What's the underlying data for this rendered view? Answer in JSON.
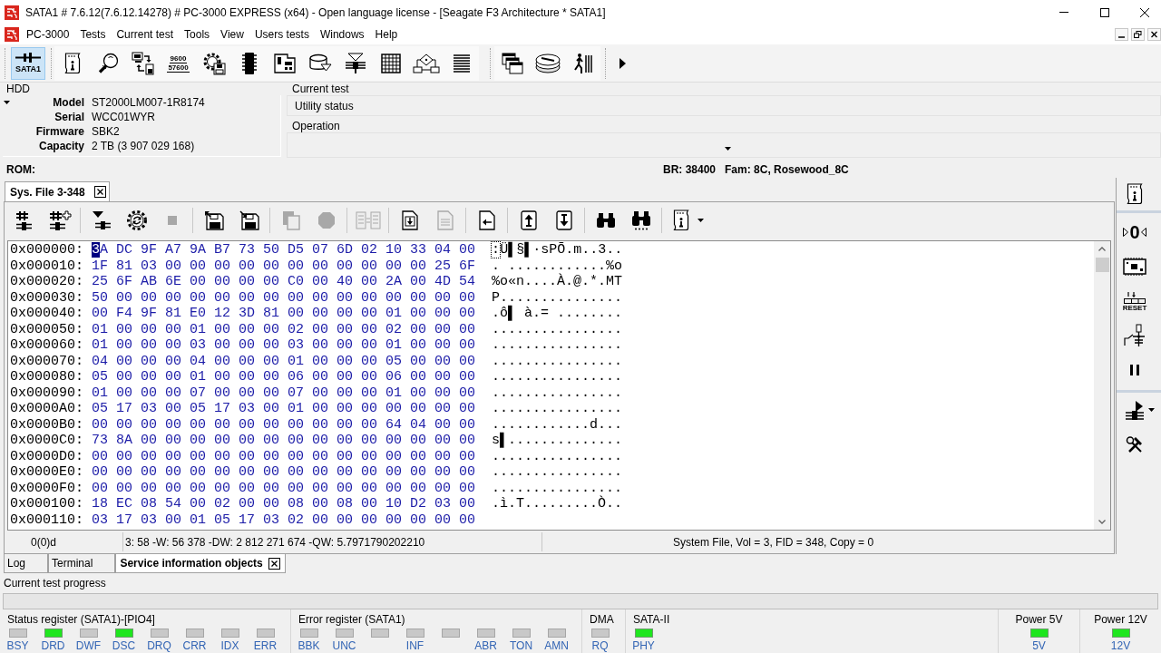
{
  "window": {
    "title": "SATA1 # 7.6.12(7.6.12.14278) # PC-3000 EXPRESS (x64) - Open language license - [Seagate F3 Architecture * SATA1]"
  },
  "menu_bar": {
    "items": [
      "PC-3000",
      "Tests",
      "Current test",
      "Tools",
      "View",
      "Users tests",
      "Windows",
      "Help"
    ]
  },
  "toolbar": {
    "port_button": {
      "label": "SATA1",
      "selected": true
    },
    "baud_button": {
      "lines": [
        "9600",
        "57600"
      ]
    }
  },
  "hdd": {
    "title": "HDD",
    "fields": [
      {
        "label": "Model",
        "value": "ST2000LM007-1R8174"
      },
      {
        "label": "Serial",
        "value": "WCC01WYR"
      },
      {
        "label": "Firmware",
        "value": "SBK2"
      },
      {
        "label": "Capacity",
        "value": "2 TB (3 907 029 168)"
      }
    ]
  },
  "current_test": {
    "title": "Current test",
    "value": "Utility status"
  },
  "operation": {
    "title": "Operation"
  },
  "rom_bar": {
    "rom": "ROM:",
    "baud": "BR: 38400",
    "family": "Fam: 8C, Rosewood_8C"
  },
  "document_tab": {
    "label": "Sys. File 3-348"
  },
  "document_toolbar": {
    "groups": [
      {
        "buttons": [
          {
            "disabled": false
          },
          {
            "disabled": false
          }
        ]
      },
      {
        "buttons": [
          {
            "disabled": false
          },
          {
            "disabled": false
          },
          {
            "disabled": true
          }
        ]
      },
      {
        "buttons": [
          {
            "disabled": false
          },
          {
            "disabled": false
          }
        ]
      },
      {
        "buttons": [
          {
            "disabled": true
          },
          {
            "disabled": true
          }
        ]
      },
      {
        "buttons": [
          {
            "disabled": true
          }
        ]
      },
      {
        "buttons": [
          {
            "disabled": false
          },
          {
            "disabled": true
          }
        ]
      },
      {
        "buttons": [
          {
            "disabled": false
          }
        ]
      },
      {
        "buttons": [
          {
            "disabled": false
          },
          {
            "disabled": false
          }
        ]
      },
      {
        "buttons": [
          {
            "disabled": false
          },
          {
            "disabled": false
          }
        ]
      },
      {
        "buttons": [
          {
            "disabled": false
          }
        ]
      }
    ]
  },
  "hex_view": {
    "rows": [
      {
        "offset": "0x000000:",
        "hex": "3A DC 9F A7 9A B7 73 50 D5 07 6D 02 10 33 04 00",
        "ascii": ":Ü▌§▌·sPÕ.m..3..",
        "selected": true
      },
      {
        "offset": "0x000010:",
        "hex": "1F 81 03 00 00 00 00 00 00 00 00 00 00 00 25 6F",
        "ascii": ". ............%o",
        "selected": false
      },
      {
        "offset": "0x000020:",
        "hex": "25 6F AB 6E 00 00 00 00 C0 00 40 00 2A 00 4D 54",
        "ascii": "%o«n....À.@.*.MT",
        "selected": false
      },
      {
        "offset": "0x000030:",
        "hex": "50 00 00 00 00 00 00 00 00 00 00 00 00 00 00 00",
        "ascii": "P...............",
        "selected": false
      },
      {
        "offset": "0x000040:",
        "hex": "00 F4 9F 81 E0 12 3D 81 00 00 00 00 01 00 00 00",
        "ascii": ".ô▌ à.= ........",
        "selected": false
      },
      {
        "offset": "0x000050:",
        "hex": "01 00 00 00 01 00 00 00 02 00 00 00 02 00 00 00",
        "ascii": "................",
        "selected": false
      },
      {
        "offset": "0x000060:",
        "hex": "01 00 00 00 03 00 00 00 03 00 00 00 01 00 00 00",
        "ascii": "................",
        "selected": false
      },
      {
        "offset": "0x000070:",
        "hex": "04 00 00 00 04 00 00 00 01 00 00 00 05 00 00 00",
        "ascii": "................",
        "selected": false
      },
      {
        "offset": "0x000080:",
        "hex": "05 00 00 00 01 00 00 00 06 00 00 00 06 00 00 00",
        "ascii": "................",
        "selected": false
      },
      {
        "offset": "0x000090:",
        "hex": "01 00 00 00 07 00 00 00 07 00 00 00 01 00 00 00",
        "ascii": "................",
        "selected": false
      },
      {
        "offset": "0x0000A0:",
        "hex": "05 17 03 00 05 17 03 00 01 00 00 00 00 00 00 00",
        "ascii": "................",
        "selected": false
      },
      {
        "offset": "0x0000B0:",
        "hex": "00 00 00 00 00 00 00 00 00 00 00 00 64 04 00 00",
        "ascii": "............d...",
        "selected": false
      },
      {
        "offset": "0x0000C0:",
        "hex": "73 8A 00 00 00 00 00 00 00 00 00 00 00 00 00 00",
        "ascii": "s▌..............",
        "selected": false
      },
      {
        "offset": "0x0000D0:",
        "hex": "00 00 00 00 00 00 00 00 00 00 00 00 00 00 00 00",
        "ascii": "................",
        "selected": false
      },
      {
        "offset": "0x0000E0:",
        "hex": "00 00 00 00 00 00 00 00 00 00 00 00 00 00 00 00",
        "ascii": "................",
        "selected": false
      },
      {
        "offset": "0x0000F0:",
        "hex": "00 00 00 00 00 00 00 00 00 00 00 00 00 00 00 00",
        "ascii": "................",
        "selected": false
      },
      {
        "offset": "0x000100:",
        "hex": "18 EC 08 54 00 02 00 00 08 00 08 00 10 D2 03 00",
        "ascii": ".ì.T.........Ò..",
        "selected": false
      },
      {
        "offset": "0x000110:",
        "hex": "03 17 03 00 01 05 17 03 02 00 00 00 00 00 00 00",
        "selected": false
      }
    ]
  },
  "document_status": {
    "position": "0(0)d",
    "values": "3: 58 -W: 56 378 -DW: 2 812 271 674 -QW: 5.7971790202210",
    "file_info": "System File, Vol = 3, FID = 348, Copy = 0"
  },
  "side_toolbar": {
    "zero_label": "0",
    "reset_label": "RESET"
  },
  "bottom_tabs": [
    {
      "label": "Log",
      "selected": false
    },
    {
      "label": "Terminal",
      "selected": false
    },
    {
      "label": "Service information objects",
      "selected": true
    }
  ],
  "progress": {
    "label": "Current test progress",
    "level": 0
  },
  "registers": [
    {
      "kind": "register",
      "title": "Status register (SATA1)-[PIO4]",
      "leds": [
        {
          "label": "BSY",
          "on": false
        },
        {
          "label": "DRD",
          "on": true
        },
        {
          "label": "DWF",
          "on": false
        },
        {
          "label": "DSC",
          "on": true
        },
        {
          "label": "DRQ",
          "on": false
        },
        {
          "label": "CRR",
          "on": false
        },
        {
          "label": "IDX",
          "on": false
        },
        {
          "label": "ERR",
          "on": false
        }
      ]
    },
    {
      "kind": "register",
      "title": "Error register (SATA1)",
      "leds": [
        {
          "label": "BBK",
          "on": false
        },
        {
          "label": "UNC",
          "on": false
        },
        {
          "on": false
        },
        {
          "label": "INF",
          "on": false
        },
        {
          "on": false
        },
        {
          "label": "ABR",
          "on": false
        },
        {
          "label": "TON",
          "on": false
        },
        {
          "label": "AMN",
          "on": false
        }
      ]
    },
    {
      "kind": "register",
      "title": "DMA",
      "leds": [
        {
          "label": "RQ",
          "on": false
        }
      ]
    },
    {
      "kind": "register",
      "title": "SATA-II",
      "leds": [
        {
          "label": "PHY",
          "on": true
        }
      ]
    },
    {
      "kind": "power",
      "title": "Power 5V",
      "leds": [
        {
          "label": "5V",
          "on": true
        }
      ]
    },
    {
      "kind": "power",
      "title": "Power 12V",
      "leds": [
        {
          "label": "12V",
          "on": true
        }
      ]
    }
  ]
}
